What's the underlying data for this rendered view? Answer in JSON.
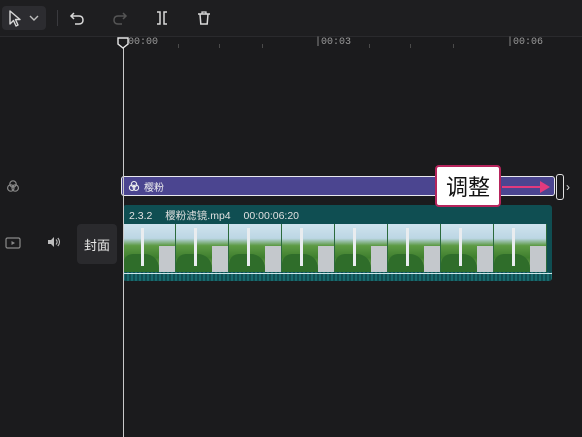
{
  "toolbar": {
    "tools": [
      "select-tool",
      "undo",
      "redo",
      "split",
      "delete"
    ]
  },
  "ruler": {
    "labels": [
      "00:00",
      "|00:03",
      "|00:06"
    ]
  },
  "tracks": {
    "cover_label": "封面",
    "filter_clip": {
      "label": "樱粉",
      "color": "#4b4590"
    },
    "video_clip": {
      "speed": "2.3.2",
      "filename": "樱粉滤镜.mp4",
      "duration": "00:00:06:20",
      "color": "#0f4e52"
    }
  },
  "annotation": {
    "label": "调整",
    "accent": "#e23a7d"
  }
}
